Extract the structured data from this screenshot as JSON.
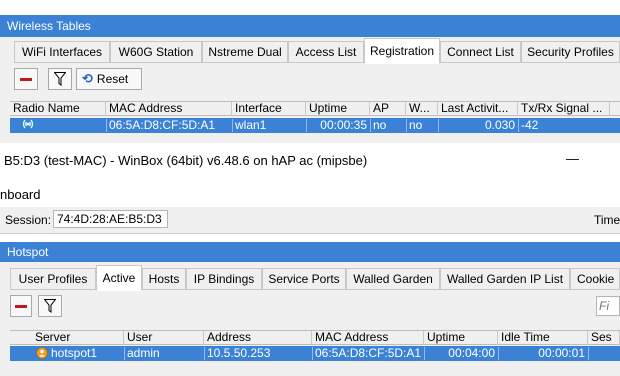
{
  "wireless": {
    "title": "Wireless Tables",
    "tabs": [
      "WiFi Interfaces",
      "W60G Station",
      "Nstreme Dual",
      "Access List",
      "Registration",
      "Connect List",
      "Security Profiles"
    ],
    "active_tab": "Registration",
    "reset_label": "Reset",
    "columns": [
      "Radio Name",
      "MAC Address",
      "Interface",
      "Uptime",
      "AP",
      "W...",
      "Last Activit...",
      "Tx/Rx Signal ..."
    ],
    "row": {
      "mac": "06:5A:D8:CF:5D:A1",
      "interface": "wlan1",
      "uptime": "00:00:35",
      "ap": "no",
      "w": "no",
      "last_activity": "0.030",
      "signal": "-42"
    }
  },
  "winbox": {
    "title": "B5:D3 (test-MAC) - WinBox (64bit) v6.48.6 on hAP ac (mipsbe)",
    "minimize": "—",
    "menu": "nboard",
    "session_label": "Session:",
    "session_value": "74:4D:28:AE:B5:D3",
    "time_label": "Time"
  },
  "hotspot": {
    "title": "Hotspot",
    "tabs": [
      "User Profiles",
      "Active",
      "Hosts",
      "IP Bindings",
      "Service Ports",
      "Walled Garden",
      "Walled Garden IP List",
      "Cookie"
    ],
    "active_tab": "Active",
    "find_placeholder": "Fi",
    "columns": [
      "Server",
      "User",
      "Address",
      "MAC Address",
      "Uptime",
      "Idle Time",
      "Ses"
    ],
    "row": {
      "server": "hotspot1",
      "user": "admin",
      "address": "10.5.50.253",
      "mac": "06:5A:D8:CF:5D:A1",
      "uptime": "00:04:00",
      "idle": "00:00:01"
    }
  },
  "colors": {
    "titlebar": "#3b82d6",
    "selection": "#3b82d6",
    "remove": "#c0161c"
  }
}
